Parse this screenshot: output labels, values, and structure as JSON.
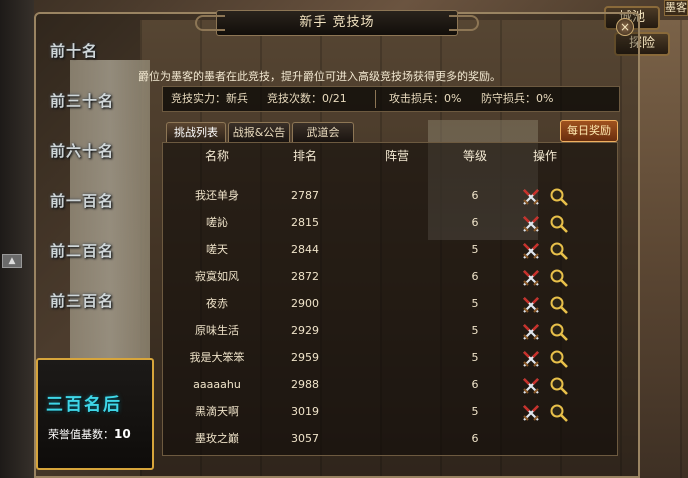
{
  "window": {
    "title": "新手 竞技场",
    "close_glyph": "×"
  },
  "top_buttons": {
    "city": "城池",
    "explore": "探险",
    "edge": "墨客"
  },
  "ladder": {
    "tiers": [
      "前十名",
      "前三十名",
      "前六十名",
      "前一百名",
      "前二百名",
      "前三百名"
    ],
    "current_tier": "三百名后",
    "honor_label": "荣誉值基数：",
    "honor_value": "10"
  },
  "description": "爵位为墨客的墨者在此竞技，提升爵位可进入高级竞技场获得更多的奖励。",
  "stats": {
    "strength": "竞技实力：新兵",
    "count": "竞技次数：0/21",
    "attack_loss": "攻击损兵：0%",
    "defense_loss": "防守损兵：0%"
  },
  "tabs": [
    {
      "label": "挑战列表",
      "active": true
    },
    {
      "label": "战报&公告",
      "active": false
    },
    {
      "label": "武道会",
      "active": false
    }
  ],
  "daily_reward": "每日奖励",
  "table": {
    "headers": {
      "name": "名称",
      "rank": "排名",
      "camp": "阵营",
      "level": "等级",
      "action": "操作"
    },
    "rows": [
      {
        "name": "我还单身",
        "rank": "2787",
        "camp": "",
        "level": "6",
        "actions": true
      },
      {
        "name": "嗟訫",
        "rank": "2815",
        "camp": "",
        "level": "6",
        "actions": true
      },
      {
        "name": "嗟天",
        "rank": "2844",
        "camp": "",
        "level": "5",
        "actions": true
      },
      {
        "name": "寂寞如风",
        "rank": "2872",
        "camp": "",
        "level": "6",
        "actions": true
      },
      {
        "name": "夜赤",
        "rank": "2900",
        "camp": "",
        "level": "5",
        "actions": true
      },
      {
        "name": "原味生活",
        "rank": "2929",
        "camp": "",
        "level": "5",
        "actions": true
      },
      {
        "name": "我是大笨笨",
        "rank": "2959",
        "camp": "",
        "level": "5",
        "actions": true
      },
      {
        "name": "aaaaahu",
        "rank": "2988",
        "camp": "",
        "level": "6",
        "actions": true
      },
      {
        "name": "黑滴天啊",
        "rank": "3019",
        "camp": "",
        "level": "5",
        "actions": true
      },
      {
        "name": "墨玫之巅",
        "rank": "3057",
        "camp": "",
        "level": "6",
        "actions": false
      }
    ]
  },
  "icons": {
    "challenge": "crossed-swords-icon",
    "view": "magnifier-icon"
  },
  "colors": {
    "accent_gold": "#d7a53b",
    "tier_cyan": "#3fd7e8",
    "daily_btn": "#a0521e"
  }
}
